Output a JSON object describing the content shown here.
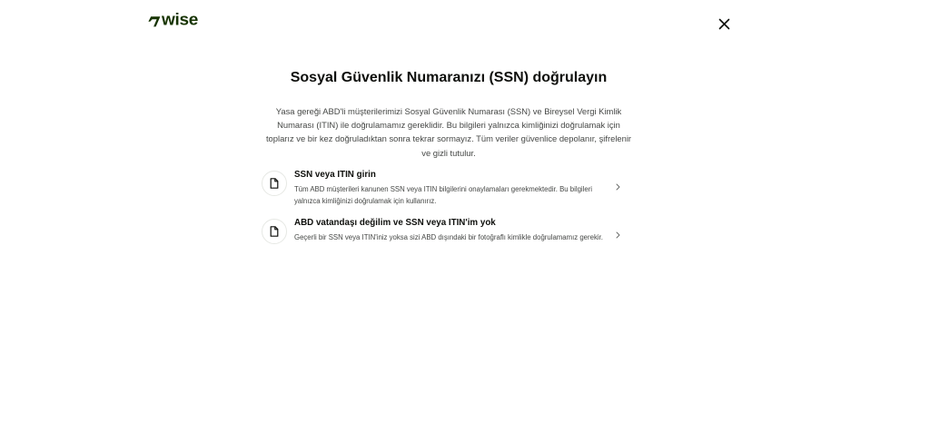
{
  "header": {
    "logo_text": "wise",
    "logo_icon": "wise-flag-icon",
    "close_icon": "close-icon",
    "brand_color": "#163300"
  },
  "main": {
    "title": "Sosyal Güvenlik Numaranızı (SSN) doğrulayın",
    "intro": "Yasa gereği ABD'li müşterilerimizi Sosyal Güvenlik Numarası (SSN) ve Bireysel Vergi Kimlik Numarası (ITIN) ile doğrulamamız gereklidir. Bu bilgileri yalnızca kimliğinizi doğrulamak için toplarız ve bir kez doğruladıktan sonra tekrar sormayız. Tüm veriler güvenlice depolanır, şifrelenir ve gizli tutulur.",
    "options": [
      {
        "title": "SSN veya ITIN girin",
        "description": "Tüm ABD müşterileri kanunen SSN veya ITIN bilgilerini onaylamaları gerekmektedir. Bu bilgileri yalnızca kimliğinizi doğrulamak için kullanırız.",
        "icon": "document-icon",
        "chevron": "chevron-right-icon"
      },
      {
        "title": "ABD vatandaşı değilim ve SSN veya ITIN'im yok",
        "description": "Geçerli bir SSN veya ITIN'iniz yoksa sizi ABD dışındaki bir fotoğraflı kimlikle doğrulamamız gerekir.",
        "icon": "document-icon",
        "chevron": "chevron-right-icon"
      }
    ]
  }
}
